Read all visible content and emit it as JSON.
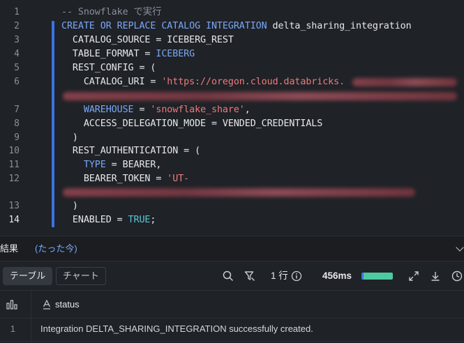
{
  "editor": {
    "lines": [
      {
        "num": "1",
        "active": false,
        "segments": [
          {
            "t": "-- Snowflake で実行",
            "c": "cm"
          }
        ]
      },
      {
        "num": "2",
        "active": false,
        "segments": [
          {
            "t": "CREATE OR REPLACE CATALOG INTEGRATION",
            "c": "kw"
          },
          {
            "t": " delta_sharing_integration",
            "c": ""
          }
        ]
      },
      {
        "num": "3",
        "active": false,
        "segments": [
          {
            "t": "  CATALOG_SOURCE = ICEBERG_REST",
            "c": ""
          }
        ]
      },
      {
        "num": "4",
        "active": false,
        "segments": [
          {
            "t": "  TABLE_FORMAT = ",
            "c": ""
          },
          {
            "t": "ICEBERG",
            "c": "kw"
          }
        ]
      },
      {
        "num": "5",
        "active": false,
        "segments": [
          {
            "t": "  REST_CONFIG = (",
            "c": ""
          }
        ]
      },
      {
        "num": "6",
        "active": false,
        "segments": [
          {
            "t": "    CATALOG_URI = ",
            "c": ""
          },
          {
            "t": "'https://oregon.cloud.databricks.",
            "c": "str"
          }
        ]
      },
      {
        "num": "7",
        "active": false,
        "segments": [
          {
            "t": "    ",
            "c": ""
          },
          {
            "t": "WAREHOUSE",
            "c": "kw"
          },
          {
            "t": " = ",
            "c": ""
          },
          {
            "t": "'snowflake_share'",
            "c": "str"
          },
          {
            "t": ",",
            "c": ""
          }
        ]
      },
      {
        "num": "8",
        "active": false,
        "segments": [
          {
            "t": "    ACCESS_DELEGATION_MODE = VENDED_CREDENTIALS",
            "c": ""
          }
        ]
      },
      {
        "num": "9",
        "active": false,
        "segments": [
          {
            "t": "  )",
            "c": ""
          }
        ]
      },
      {
        "num": "10",
        "active": false,
        "segments": [
          {
            "t": "  REST_AUTHENTICATION = (",
            "c": ""
          }
        ]
      },
      {
        "num": "11",
        "active": false,
        "segments": [
          {
            "t": "    ",
            "c": ""
          },
          {
            "t": "TYPE",
            "c": "kw"
          },
          {
            "t": " = BEARER,",
            "c": ""
          }
        ]
      },
      {
        "num": "12",
        "active": false,
        "segments": [
          {
            "t": "    BEARER_TOKEN = ",
            "c": ""
          },
          {
            "t": "'UT-",
            "c": "str"
          }
        ]
      },
      {
        "num": "13",
        "active": false,
        "segments": [
          {
            "t": "  )",
            "c": ""
          }
        ]
      },
      {
        "num": "14",
        "active": true,
        "segments": [
          {
            "t": "  ENABLED = ",
            "c": ""
          },
          {
            "t": "TRUE",
            "c": "kw2"
          },
          {
            "t": ";",
            "c": ""
          }
        ]
      }
    ]
  },
  "results": {
    "tab_label": "結果",
    "tab_time": "(たった今)"
  },
  "toolbar": {
    "table_label": "テーブル",
    "chart_label": "チャート",
    "rows_label": "1 行",
    "duration": "456ms",
    "progress": 1.0
  },
  "grid": {
    "column_header": "status",
    "rows": [
      {
        "num": "1",
        "status": "Integration DELTA_SHARING_INTEGRATION successfully created."
      }
    ]
  },
  "colors": {
    "keyword": "#7aa7f5",
    "string": "#f17a7a",
    "selection_bar": "#3a73e0",
    "progress": "#4ec9a0"
  },
  "icons": [
    "search-icon",
    "filter-icon",
    "info-icon",
    "expand-icon",
    "download-icon",
    "clock-icon",
    "chevron-down-icon",
    "column-stats-icon",
    "text-type-icon"
  ]
}
